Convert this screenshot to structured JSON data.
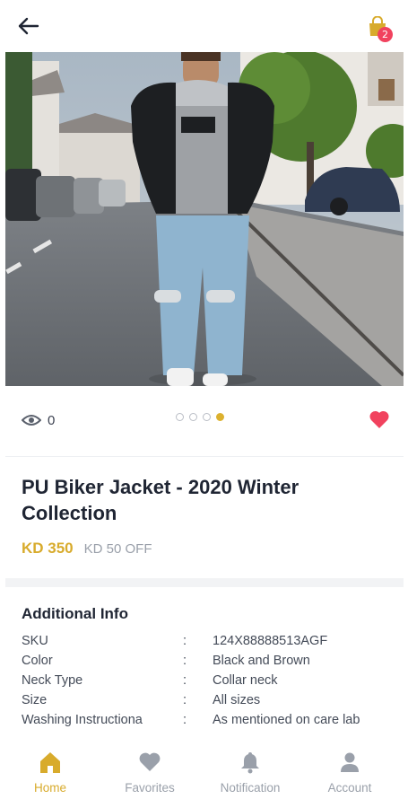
{
  "header": {
    "back_icon": "arrow-left-icon",
    "cart_icon": "shopping-bag-icon",
    "cart_count": "2"
  },
  "product": {
    "image_icon": "product-photo",
    "image_count": 4,
    "active_image": 4,
    "views_icon": "eye-icon",
    "views": "0",
    "favorite_icon": "heart-icon",
    "title": "PU Biker Jacket - 2020 Winter Collection",
    "price": "KD 350",
    "discount": "KD 50 OFF"
  },
  "additional_info": {
    "title": "Additional Info",
    "rows": [
      {
        "label": "SKU",
        "sep": ":",
        "value": "124X88888513AGF"
      },
      {
        "label": "Color",
        "sep": ":",
        "value": "Black and Brown"
      },
      {
        "label": "Neck Type",
        "sep": ":",
        "value": "Collar neck"
      },
      {
        "label": "Size",
        "sep": ":",
        "value": "All sizes"
      },
      {
        "label": "Washing Instructiona",
        "sep": ":",
        "value": "As mentioned on care lab"
      }
    ]
  },
  "nav": {
    "items": [
      {
        "label": "Home",
        "icon": "home-icon"
      },
      {
        "label": "Favorites",
        "icon": "heart-icon"
      },
      {
        "label": "Notification",
        "icon": "bell-icon"
      },
      {
        "label": "Account",
        "icon": "user-icon"
      }
    ]
  },
  "colors": {
    "accent": "#d8ab2c",
    "badge": "#f1425e",
    "favorite": "#f1425e",
    "text_dark": "#1f2533",
    "text_muted": "#9aa0aa"
  }
}
